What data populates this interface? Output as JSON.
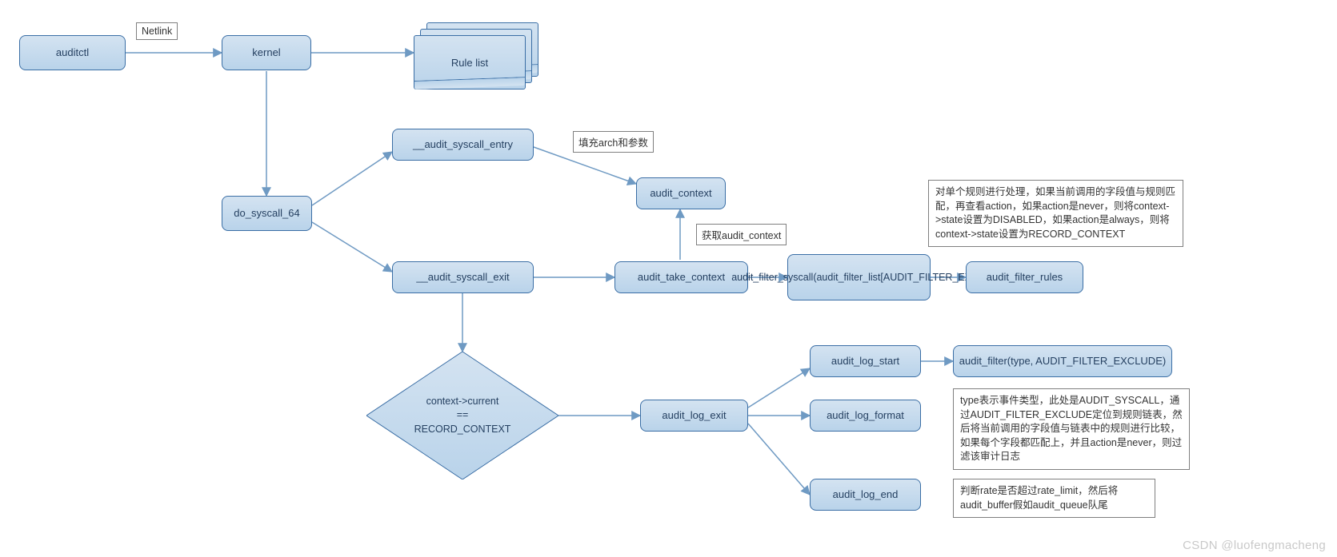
{
  "nodes": {
    "auditctl": "auditctl",
    "kernel": "kernel",
    "rule_list": "Rule list",
    "do_syscall_64": "do_syscall_64",
    "audit_syscall_entry": "__audit_syscall_entry",
    "audit_context": "audit_context",
    "audit_syscall_exit": "__audit_syscall_exit",
    "audit_take_context": "audit_take_context",
    "audit_filter_syscall": "audit_filter_syscall(audit_filter_list[AUDIT_FILTER_EXIT])",
    "audit_filter_rules": "audit_filter_rules",
    "decision": "context->current\n==\nRECORD_CONTEXT",
    "audit_log_exit": "audit_log_exit",
    "audit_log_start": "audit_log_start",
    "audit_log_format": "audit_log_format",
    "audit_log_end": "audit_log_end",
    "audit_filter_exclude": "audit_filter(type, AUDIT_FILTER_EXCLUDE)"
  },
  "labels": {
    "netlink": "Netlink",
    "fill_arch": "填充arch和参数",
    "get_audit_context": "获取audit_context"
  },
  "notes": {
    "rule_processing": "对单个规则进行处理，如果当前调用的字段值与规则匹配，再查看action，如果action是never，则将context->state设置为DISABLED，如果action是always，则将context->state设置为RECORD_CONTEXT",
    "exclude_note": "type表示事件类型，此处是AUDIT_SYSCALL，通过AUDIT_FILTER_EXCLUDE定位到规则链表，然后将当前调用的字段值与链表中的规则进行比较，如果每个字段都匹配上，并且action是never，则过滤该审计日志",
    "end_note": "判断rate是否超过rate_limit，然后将audit_buffer假如audit_queue队尾"
  },
  "watermark": "CSDN @luofengmacheng"
}
